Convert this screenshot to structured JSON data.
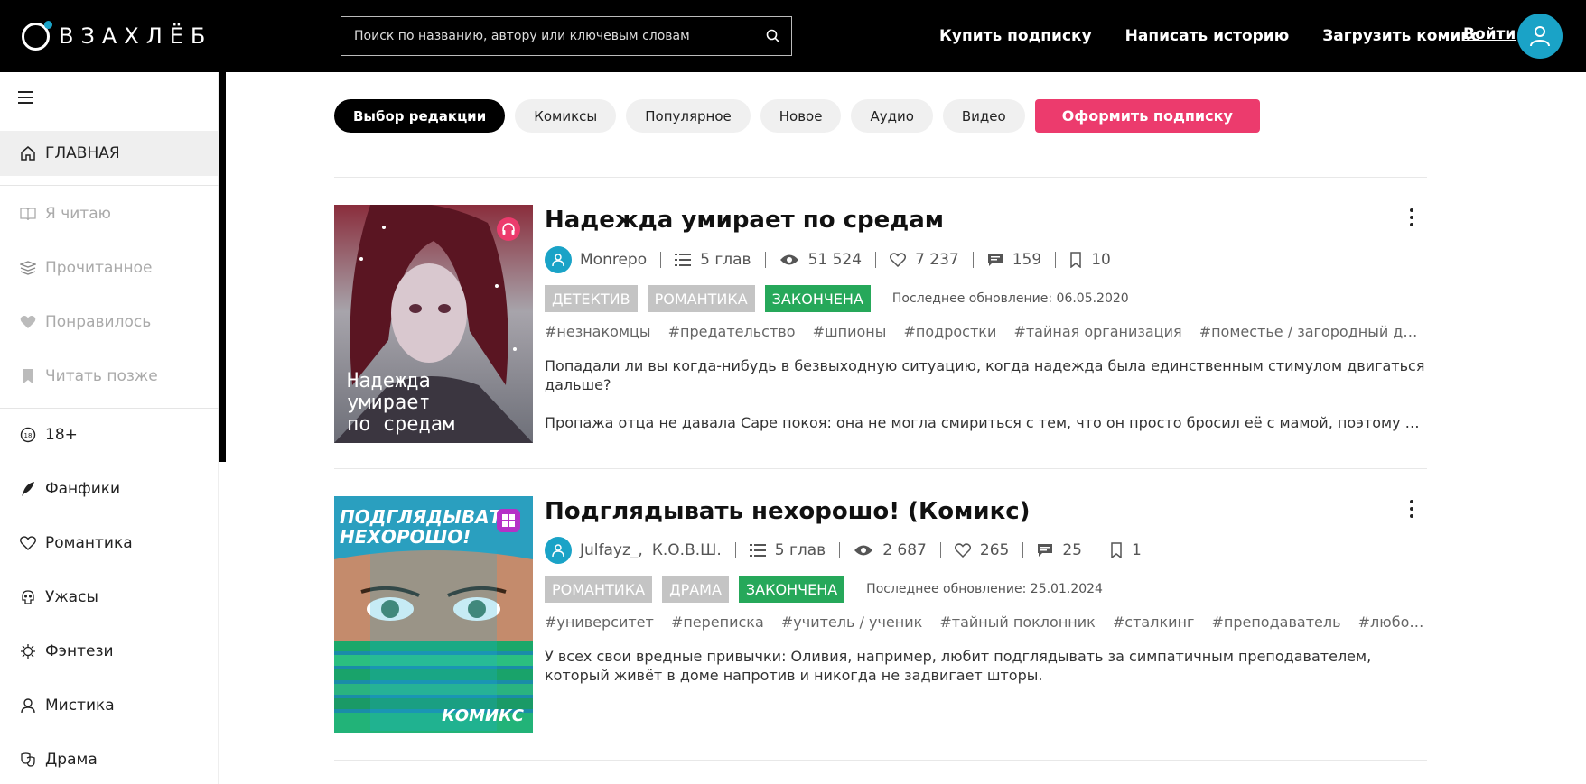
{
  "header": {
    "logo_text": "ВЗАХЛЁБ",
    "search_placeholder": "Поиск по названию, автору или ключевым словам",
    "nav": [
      "Купить подписку",
      "Написать историю",
      "Загрузить комикс"
    ],
    "login": "Войти"
  },
  "sidebar": {
    "items": [
      {
        "label": "ГЛАВНАЯ",
        "icon": "home-icon"
      },
      {
        "label": "Я читаю",
        "icon": "book-open-icon"
      },
      {
        "label": "Прочитанное",
        "icon": "stack-icon"
      },
      {
        "label": "Понравилось",
        "icon": "heart-icon"
      },
      {
        "label": "Читать позже",
        "icon": "bookmark-icon"
      },
      {
        "label": "18+",
        "icon": "age-18-icon"
      },
      {
        "label": "Фанфики",
        "icon": "quill-icon"
      },
      {
        "label": "Романтика",
        "icon": "heart-outline-icon"
      },
      {
        "label": "Ужасы",
        "icon": "skull-icon"
      },
      {
        "label": "Фэнтези",
        "icon": "dragon-icon"
      },
      {
        "label": "Мистика",
        "icon": "ghost-icon"
      },
      {
        "label": "Драма",
        "icon": "masks-icon"
      }
    ]
  },
  "filters": {
    "pills": [
      "Выбор редакции",
      "Комиксы",
      "Популярное",
      "Новое",
      "Аудио",
      "Видео"
    ],
    "subscribe": "Оформить подписку"
  },
  "stories": [
    {
      "title": "Надежда умирает по средам",
      "cover_text": "Надежда умирает по средам",
      "cover_lines": [
        "Надежда",
        "умирает",
        "по средам"
      ],
      "author": "Monrepo",
      "chapters": "5 глав",
      "views": "51 524",
      "likes": "7 237",
      "comments": "159",
      "bookmarks": "10",
      "tags": [
        "ДЕТЕКТИВ",
        "РОМАНТИКА"
      ],
      "status": "ЗАКОНЧЕНА",
      "updated": "Последнее обновление: 06.05.2020",
      "hashtags": [
        "#незнакомцы",
        "#предательство",
        "#шпионы",
        "#подростки",
        "#тайная организация",
        "#поместье / загородный дом",
        "#…"
      ],
      "desc": "Попадали ли вы когда-нибудь в безвыходную ситуацию, когда надежда была единственным стимулом двигаться дальше?",
      "desc2": "Пропажа отца не давала Саре покоя: она не могла смириться с тем, что он просто бросил её с мамой, поэтому девушк…",
      "badge_color": "#ec3b6d"
    },
    {
      "title": "Подглядывать нехорошо! (Комикс)",
      "cover_text": "ПОДГЛЯДЫВАТЬ НЕХОРОШО!",
      "cover_lines": [
        "ПОДГЛЯДЫВАТЬ",
        "НЕХОРОШО!"
      ],
      "cover_footer": "КОМИКС",
      "author": "Julfayz_,",
      "coauthor": "К.О.В.Ш.",
      "chapters": "5 глав",
      "views": "2 687",
      "likes": "265",
      "comments": "25",
      "bookmarks": "1",
      "tags": [
        "РОМАНТИКА",
        "ДРАМА"
      ],
      "status": "ЗАКОНЧЕНА",
      "updated": "Последнее обновление: 25.01.2024",
      "hashtags": [
        "#университет",
        "#переписка",
        "#учитель / ученик",
        "#тайный поклонник",
        "#сталкинг",
        "#преподаватель",
        "#любовь к уч…"
      ],
      "desc": "У всех свои вредные привычки: Оливия, например, любит подглядывать за симпатичным преподавателем, который живёт в доме напротив и никогда не задвигает шторы.",
      "badge_color": "#b531c7"
    }
  ],
  "colors": {
    "accent": "#1aa3c7",
    "pink": "#ec3b6d",
    "green": "#26a85a",
    "tag_gray": "#c4c4c4"
  }
}
